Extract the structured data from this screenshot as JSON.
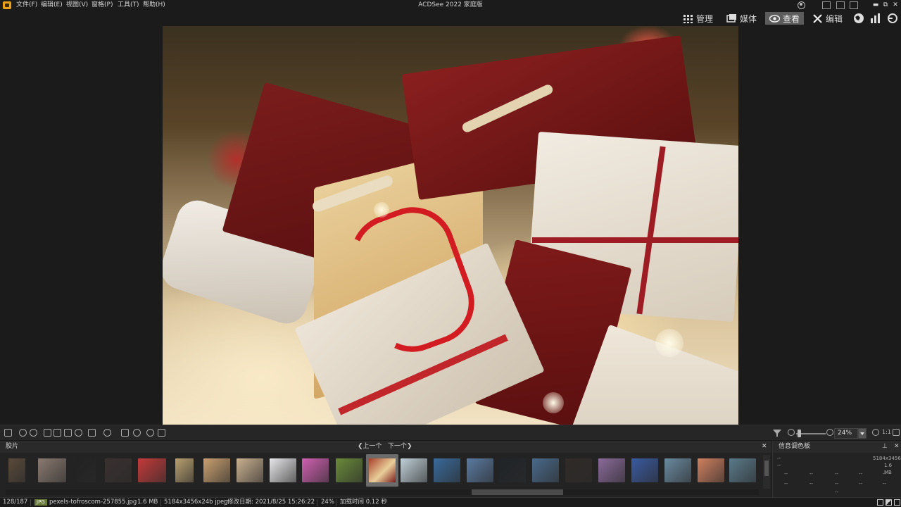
{
  "window": {
    "title": "ACDSee 2022 家庭版",
    "menu": [
      "文件(F)",
      "编辑(E)",
      "视图(V)",
      "窗格(P)",
      "工具(T)",
      "帮助(H)"
    ],
    "controls": [
      "▬",
      "⧉",
      "✕"
    ]
  },
  "modes": [
    {
      "label": "管理",
      "icon": "grid-icon",
      "active": false
    },
    {
      "label": "媒体",
      "icon": "media-icon",
      "active": false
    },
    {
      "label": "查看",
      "icon": "eye-icon",
      "active": true
    },
    {
      "label": "编辑",
      "icon": "edit-tools-icon",
      "active": false
    }
  ],
  "viewer": {
    "zoom": "24%",
    "zoom_ratio": "1:1"
  },
  "filmstrip": {
    "title": "胶片",
    "prev": "上一个",
    "next": "下一个",
    "close": "✕",
    "thumb_colors": [
      "#5a4a3a",
      "#8a7a70",
      "#222222",
      "#3a3030",
      "#c43a3a",
      "#b8a070",
      "#c9a070",
      "#c9b090",
      "#e8e8ea",
      "#d060b0",
      "#6a8a3a",
      "#a8402a",
      "#c0d0d8",
      "#3a6a9a",
      "#5a7aa0",
      "#202428",
      "#4a6a8a",
      "#302a28",
      "#8a6a9a",
      "#3a5aa0",
      "#6a8aa0",
      "#d08060",
      "#5a7a8a"
    ]
  },
  "info_palette": {
    "title": "信息调色板",
    "pin": "📌",
    "close": "✕",
    "dims": "5184x3456",
    "size": "1.6 MB",
    "dash": "--"
  },
  "status": {
    "position": "128/187",
    "type": "JPG",
    "filename": "pexels-tofroscom-257855.jpg",
    "filesize": "1.6 MB",
    "dimensions": "5184x3456x24b jpeg",
    "modified": "修改日期: 2021/8/25 15:26:22",
    "zoom": "24%",
    "loadtime": "加载时间 0.12 秒"
  }
}
